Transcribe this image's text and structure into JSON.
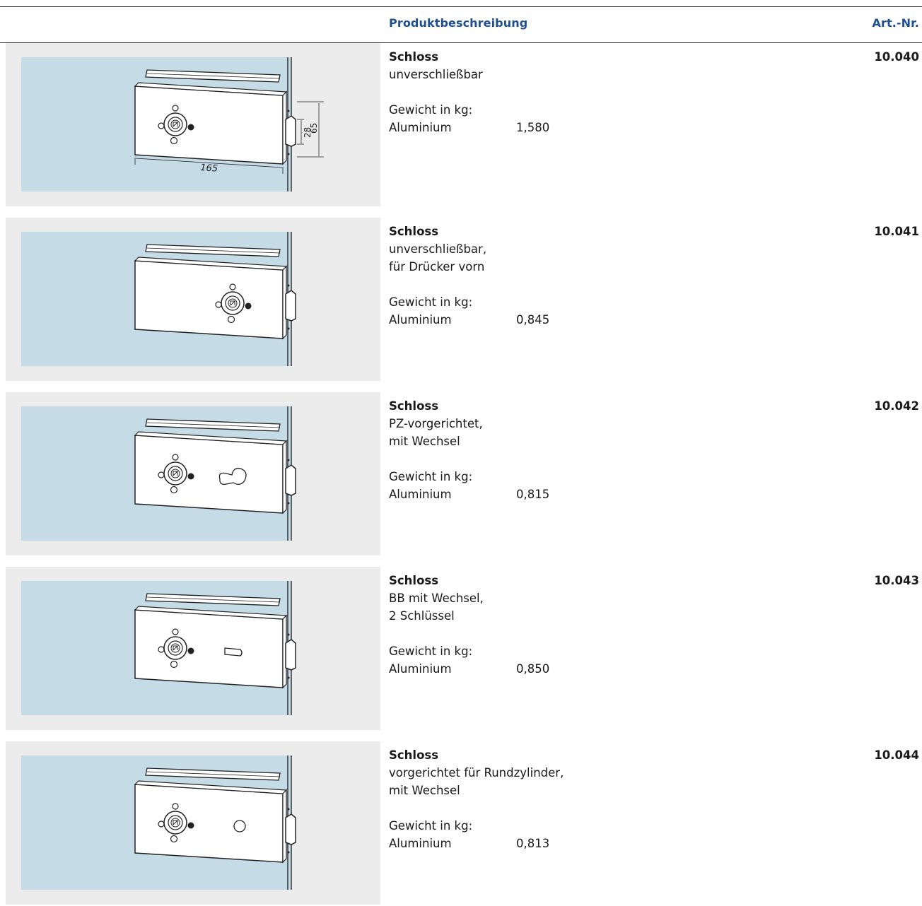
{
  "header": {
    "description_label": "Produktbeschreibung",
    "art_label": "Art.-Nr."
  },
  "drawing_dims": {
    "width": "165",
    "inner": "28",
    "outer": "65"
  },
  "products": [
    {
      "title": "Schloss",
      "lines": [
        "unverschließbar"
      ],
      "weight_label": "Gewicht in kg:",
      "material": "Aluminium",
      "weight": "1,580",
      "art": "10.040",
      "variant": "dimensioned"
    },
    {
      "title": "Schloss",
      "lines": [
        "unverschließbar,",
        "für Drücker vorn"
      ],
      "weight_label": "Gewicht in kg:",
      "material": "Aluminium",
      "weight": "0,845",
      "art": "10.041",
      "variant": "handle-front"
    },
    {
      "title": "Schloss",
      "lines": [
        "PZ-vorgerichtet,",
        "mit Wechsel"
      ],
      "weight_label": "Gewicht in kg:",
      "material": "Aluminium",
      "weight": "0,815",
      "art": "10.042",
      "variant": "profile-cylinder"
    },
    {
      "title": "Schloss",
      "lines": [
        "BB mit Wechsel,",
        "2 Schlüssel"
      ],
      "weight_label": "Gewicht in kg:",
      "material": "Aluminium",
      "weight": "0,850",
      "art": "10.043",
      "variant": "bit-key"
    },
    {
      "title": "Schloss",
      "lines": [
        "vorgerichtet für Rundzylinder,",
        "mit Wechsel"
      ],
      "weight_label": "Gewicht in kg:",
      "material": "Aluminium",
      "weight": "0,813",
      "art": "10.044",
      "variant": "round-cylinder"
    }
  ],
  "colors": {
    "header_blue": "#1f4f93",
    "glass_blue": "#c5dbe6",
    "panel_gray": "#ececec"
  }
}
